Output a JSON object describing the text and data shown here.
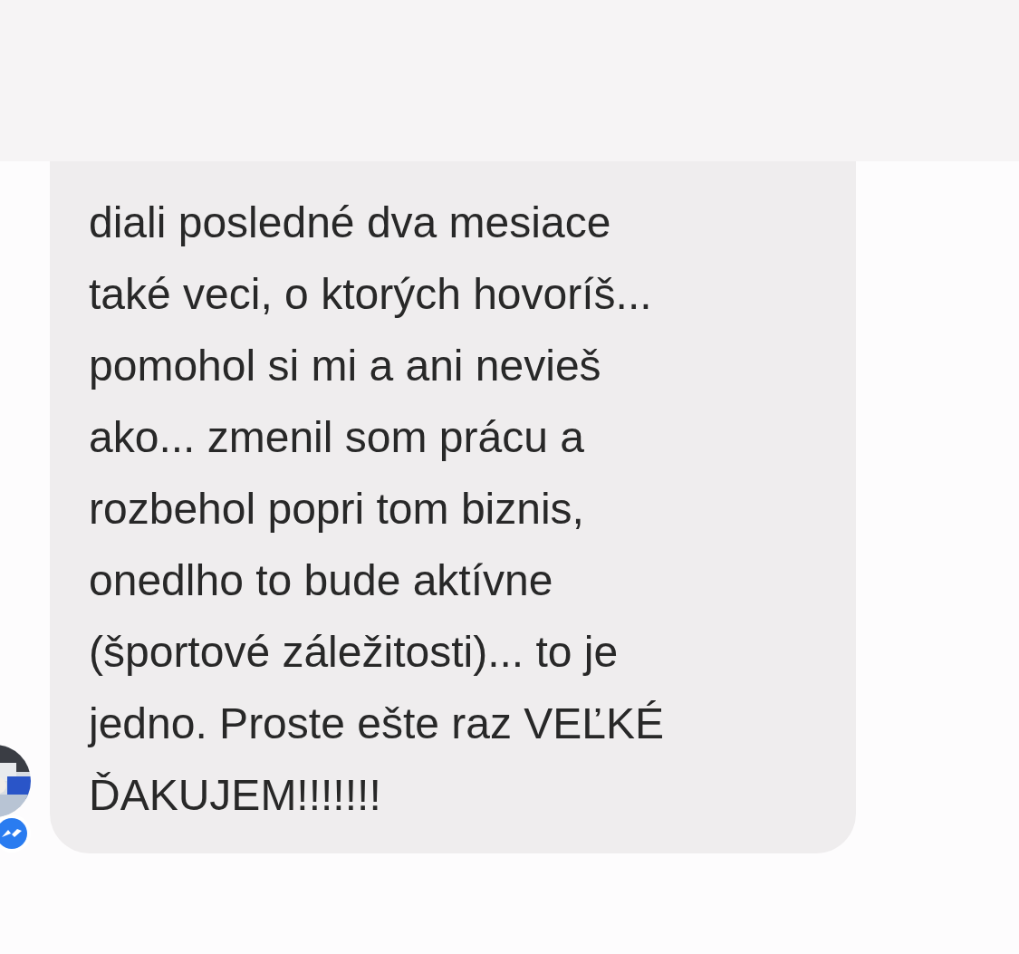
{
  "message": {
    "text": "diali posledné dva mesiace\ntaké veci, o ktorých hovoríš...\npomohol si mi a ani nevieš\nako... zmenil som prácu a\nrozbehol popri tom biznis,\nonedlho to bude aktívne\n(športové záležitosti)... to je\njedno. Proste ešte raz VEĽKÉ\nĎAKUJEM!!!!!!!"
  }
}
